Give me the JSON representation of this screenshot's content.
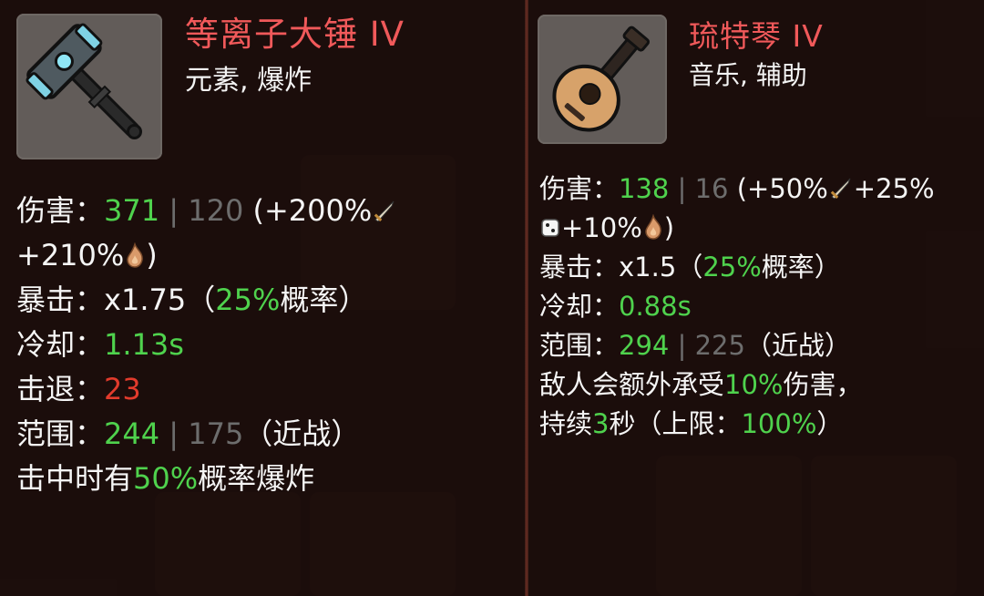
{
  "left_item": {
    "name": "等离子大锤 IV",
    "tags": "元素, 爆炸",
    "icon": "hammer-icon",
    "damage_label": "伤害：",
    "damage_value": "371",
    "damage_sep": " | ",
    "damage_base": "120",
    "damage_scaling_open": " (+200%",
    "damage_scaling_line2_prefix": "+210%",
    "damage_scaling_close": ")",
    "crit_label": "暴击：",
    "crit_mult": "x1.75",
    "crit_open": "（",
    "crit_chance": "25%",
    "crit_suffix": "概率）",
    "cooldown_label": "冷却：",
    "cooldown_value": "1.13s",
    "knockback_label": "击退：",
    "knockback_value": "23",
    "range_label": "范围：",
    "range_value": "244",
    "range_sep": " | ",
    "range_base": "175",
    "range_suffix": "（近战）",
    "effect_prefix": "击中时有",
    "effect_chance": "50%",
    "effect_suffix": "概率爆炸"
  },
  "right_item": {
    "name": "琉特琴 IV",
    "tags": "音乐, 辅助",
    "icon": "lute-icon",
    "damage_label": "伤害：",
    "damage_value": "138",
    "damage_sep": " | ",
    "damage_base": "16",
    "damage_scaling_open": " (+50%",
    "damage_scaling_mid": "+25%",
    "damage_scaling_line2": "+10%",
    "damage_scaling_close": ")",
    "crit_label": "暴击：",
    "crit_mult": "x1.5",
    "crit_open": "（",
    "crit_chance": "25%",
    "crit_suffix": "概率）",
    "cooldown_label": "冷却：",
    "cooldown_value": "0.88s",
    "range_label": "范围：",
    "range_value": "294",
    "range_sep": " | ",
    "range_base": "225",
    "range_suffix": "（近战）",
    "effect1_prefix": "敌人会额外承受",
    "effect1_value": "10%",
    "effect1_suffix": "伤害，",
    "effect2_prefix": "持续",
    "effect2_value": "3",
    "effect2_mid": "秒（上限：",
    "effect2_cap": "100%",
    "effect2_close": "）"
  },
  "colors": {
    "title": "#f0595a",
    "highlight": "#4fd24d",
    "base_stat": "#6d6d6d",
    "knockback": "#e23b2c",
    "text": "#f5f5f5"
  },
  "stat_icons": [
    "sword-icon",
    "fire-icon",
    "dice-icon"
  ]
}
